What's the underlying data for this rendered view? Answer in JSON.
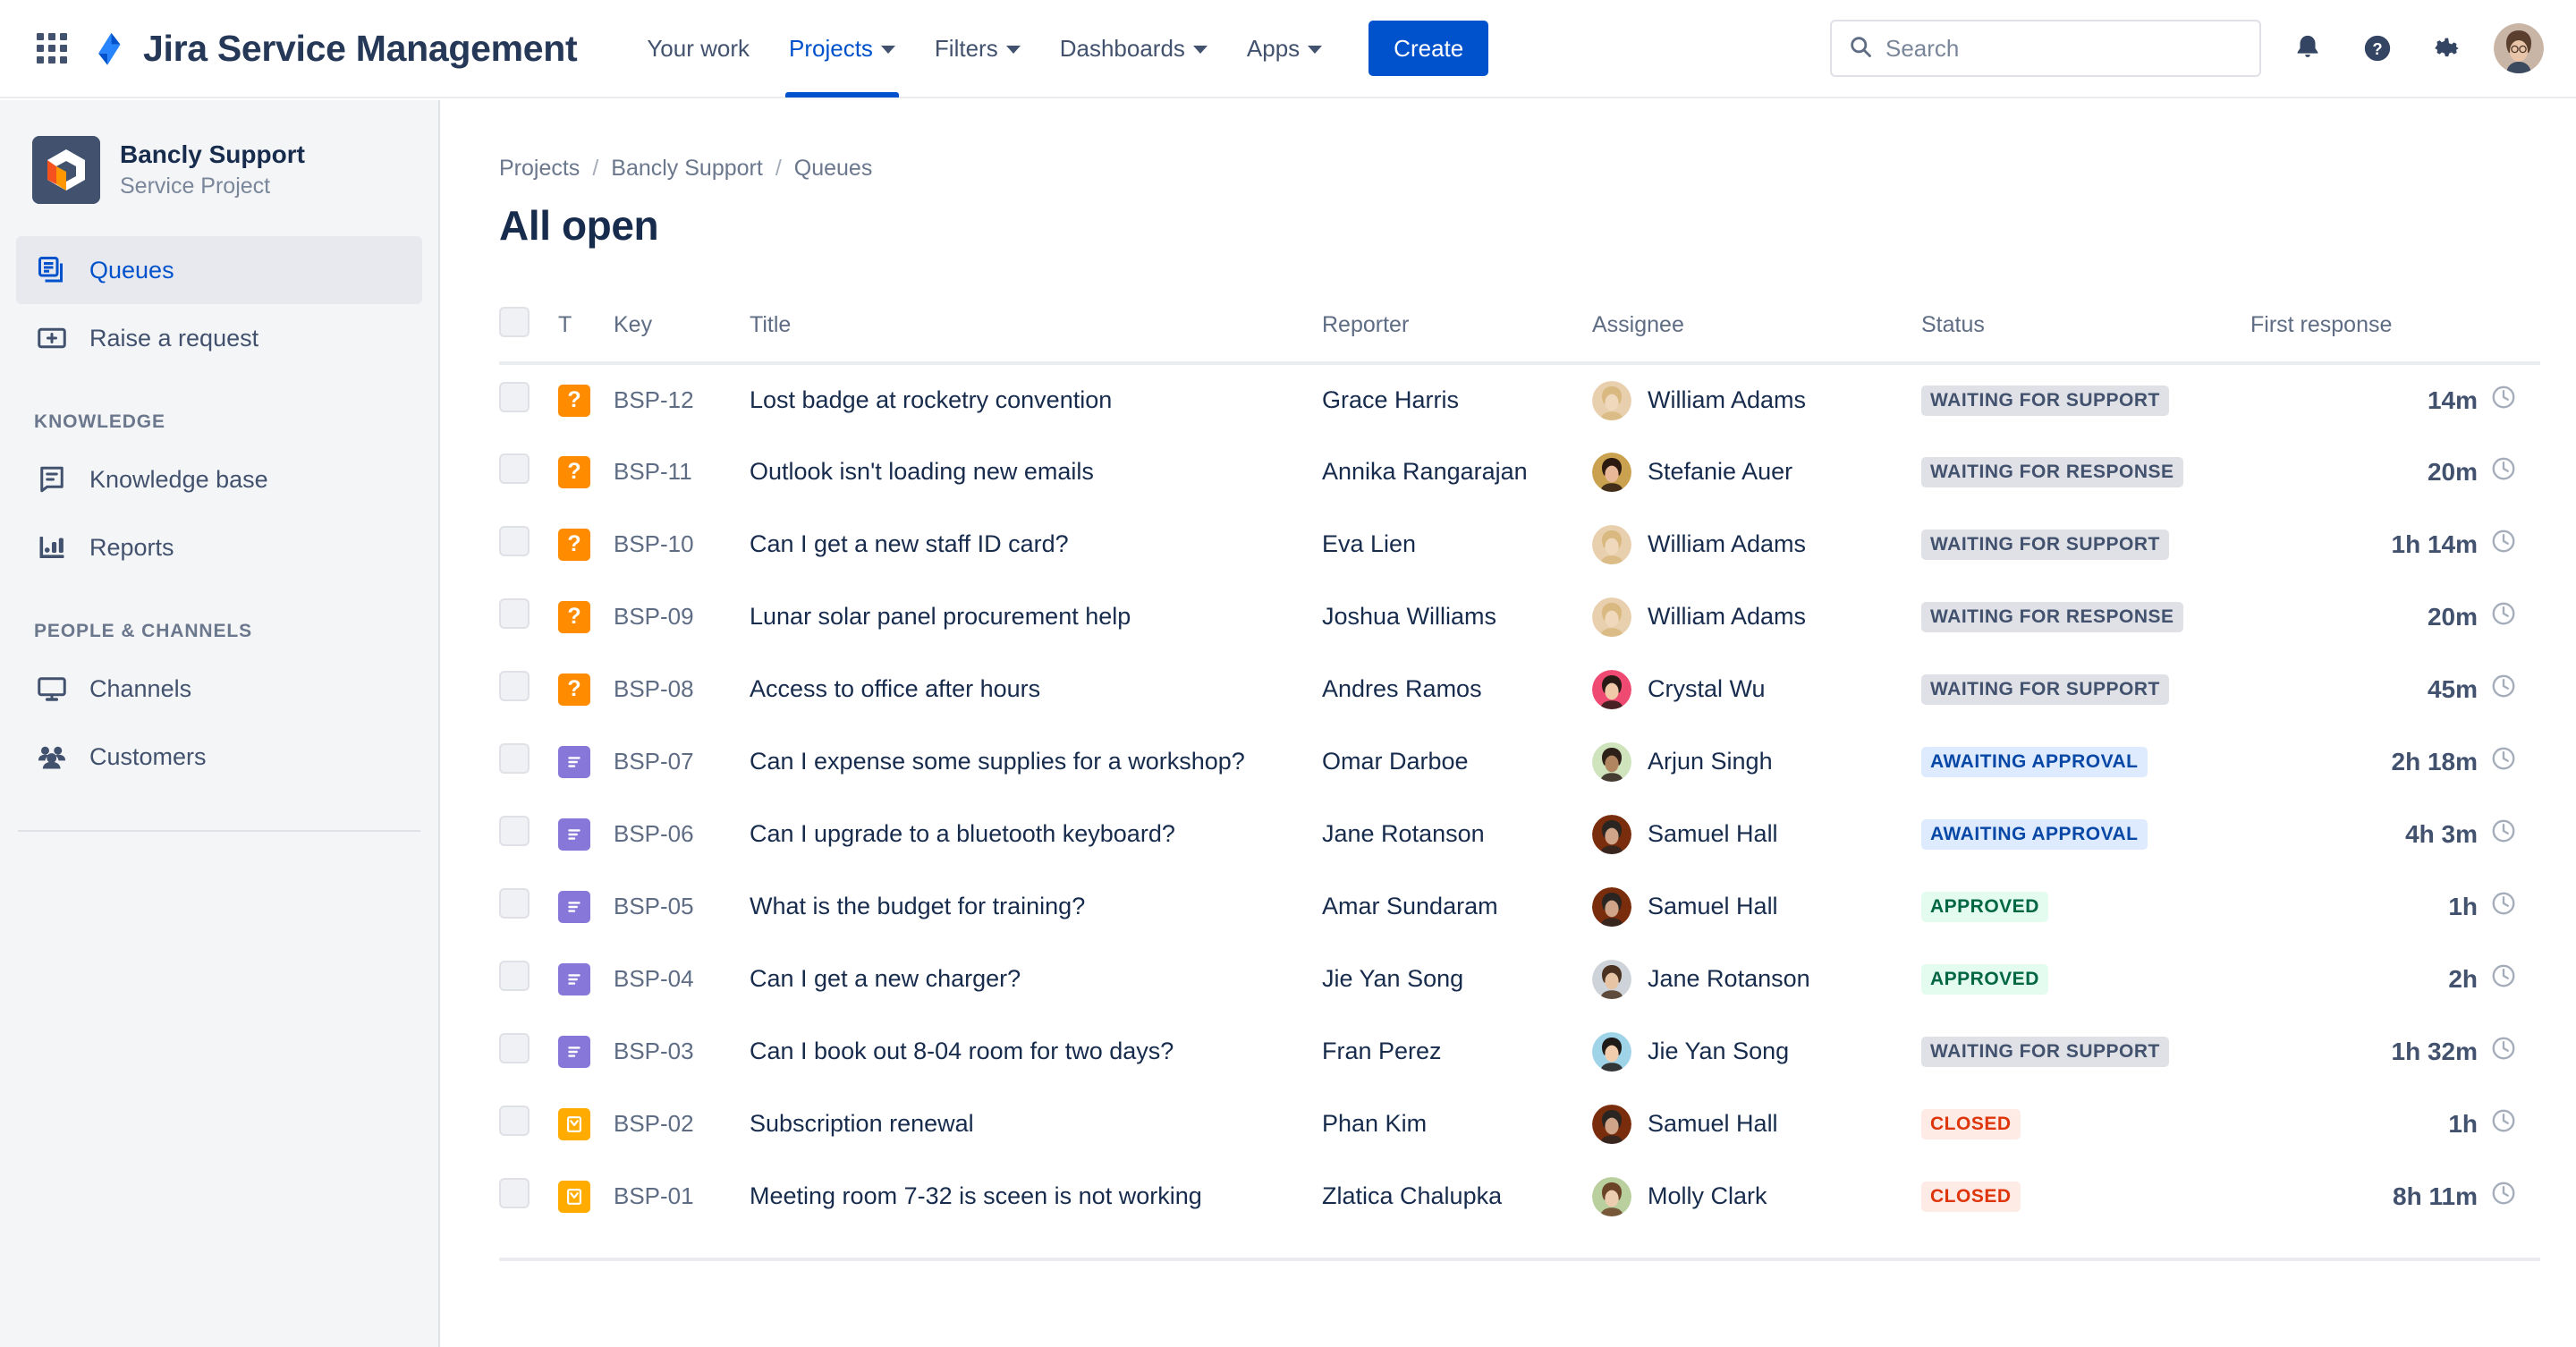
{
  "topnav": {
    "apps_icon": "apps-grid-icon",
    "logo_icon": "jira-logo-icon",
    "brand": "Jira Service Management",
    "links": [
      {
        "label": "Your work",
        "has_caret": false,
        "active": false
      },
      {
        "label": "Projects",
        "has_caret": true,
        "active": true
      },
      {
        "label": "Filters",
        "has_caret": true,
        "active": false
      },
      {
        "label": "Dashboards",
        "has_caret": true,
        "active": false
      },
      {
        "label": "Apps",
        "has_caret": true,
        "active": false
      }
    ],
    "create_label": "Create",
    "search": {
      "placeholder": "Search",
      "value": "",
      "icon": "search-icon"
    },
    "notifications_icon": "notification-bell-icon",
    "help_icon": "help-circle-icon",
    "settings_icon": "gear-icon",
    "profile_icon": "user-avatar"
  },
  "sidebar": {
    "project": {
      "name": "Bancly Support",
      "type": "Service Project",
      "avatar_icon": "project-avatar-icon"
    },
    "items": [
      {
        "label": "Queues",
        "icon": "queues-icon",
        "selected": true
      },
      {
        "label": "Raise a request",
        "icon": "raise-request-icon",
        "selected": false
      }
    ],
    "groups": [
      {
        "title": "KNOWLEDGE",
        "items": [
          {
            "label": "Knowledge base",
            "icon": "book-icon",
            "selected": false
          },
          {
            "label": "Reports",
            "icon": "bar-chart-icon",
            "selected": false
          }
        ]
      },
      {
        "title": "PEOPLE & CHANNELS",
        "items": [
          {
            "label": "Channels",
            "icon": "monitor-icon",
            "selected": false
          },
          {
            "label": "Customers",
            "icon": "people-icon",
            "selected": false
          }
        ]
      }
    ]
  },
  "main": {
    "breadcrumb": [
      "Projects",
      "Bancly Support",
      "Queues"
    ],
    "breadcrumb_separator": "/",
    "page_title": "All open",
    "table": {
      "select_all_icon": "checkbox-unchecked",
      "columns": [
        "T",
        "Key",
        "Title",
        "Reporter",
        "Assignee",
        "Status",
        "First response"
      ],
      "rows": [
        {
          "type": "question",
          "type_glyph": "?",
          "type_color": "#ff8b00",
          "key": "BSP-12",
          "title": "Lost badge at rocketry convention",
          "reporter": "Grace Harris",
          "assignee": "William Adams",
          "status": "WAITING FOR SUPPORT",
          "status_style": "grey",
          "first_response": "14m"
        },
        {
          "type": "question",
          "type_glyph": "?",
          "type_color": "#ff8b00",
          "key": "BSP-11",
          "title": "Outlook isn't loading new emails",
          "reporter": "Annika Rangarajan",
          "assignee": "Stefanie Auer",
          "status": "WAITING FOR RESPONSE",
          "status_style": "grey",
          "first_response": "20m"
        },
        {
          "type": "question",
          "type_glyph": "?",
          "type_color": "#ff8b00",
          "key": "BSP-10",
          "title": "Can I get a new staff ID card?",
          "reporter": "Eva Lien",
          "assignee": "William Adams",
          "status": "WAITING FOR SUPPORT",
          "status_style": "grey",
          "first_response": "1h 14m"
        },
        {
          "type": "question",
          "type_glyph": "?",
          "type_color": "#ff8b00",
          "key": "BSP-09",
          "title": "Lunar solar panel procurement help",
          "reporter": "Joshua Williams",
          "assignee": "William Adams",
          "status": "WAITING FOR RESPONSE",
          "status_style": "grey",
          "first_response": "20m"
        },
        {
          "type": "question",
          "type_glyph": "?",
          "type_color": "#ff8b00",
          "key": "BSP-08",
          "title": "Access to office after hours",
          "reporter": "Andres Ramos",
          "assignee": "Crystal Wu",
          "status": "WAITING FOR SUPPORT",
          "status_style": "grey",
          "first_response": "45m"
        },
        {
          "type": "task",
          "type_glyph": "",
          "type_color": "#8777d9",
          "key": "BSP-07",
          "title": "Can I expense some supplies for a workshop?",
          "reporter": "Omar Darboe",
          "assignee": "Arjun Singh",
          "status": "AWAITING APPROVAL",
          "status_style": "blue",
          "first_response": "2h 18m"
        },
        {
          "type": "task",
          "type_glyph": "",
          "type_color": "#8777d9",
          "key": "BSP-06",
          "title": "Can I upgrade to a bluetooth keyboard?",
          "reporter": "Jane Rotanson",
          "assignee": "Samuel Hall",
          "status": "AWAITING APPROVAL",
          "status_style": "blue",
          "first_response": "4h 3m"
        },
        {
          "type": "task",
          "type_glyph": "",
          "type_color": "#8777d9",
          "key": "BSP-05",
          "title": "What is the budget for training?",
          "reporter": "Amar Sundaram",
          "assignee": "Samuel Hall",
          "status": "APPROVED",
          "status_style": "green",
          "first_response": "1h"
        },
        {
          "type": "task",
          "type_glyph": "",
          "type_color": "#8777d9",
          "key": "BSP-04",
          "title": "Can I get a new charger?",
          "reporter": "Jie Yan Song",
          "assignee": "Jane Rotanson",
          "status": "APPROVED",
          "status_style": "green",
          "first_response": "2h"
        },
        {
          "type": "task",
          "type_glyph": "",
          "type_color": "#8777d9",
          "key": "BSP-03",
          "title": "Can I book out 8-04 room for two days?",
          "reporter": "Fran Perez",
          "assignee": "Jie Yan Song",
          "status": "WAITING FOR SUPPORT",
          "status_style": "grey",
          "first_response": "1h 32m"
        },
        {
          "type": "incident",
          "type_glyph": "",
          "type_color": "#ffab00",
          "key": "BSP-02",
          "title": "Subscription renewal",
          "reporter": "Phan Kim",
          "assignee": "Samuel Hall",
          "status": "CLOSED",
          "status_style": "red",
          "first_response": "1h"
        },
        {
          "type": "incident",
          "type_glyph": "",
          "type_color": "#ffab00",
          "key": "BSP-01",
          "title": "Meeting room 7-32 is sceen is not working",
          "reporter": "Zlatica Chalupka",
          "assignee": "Molly Clark",
          "status": "CLOSED",
          "status_style": "red",
          "first_response": "8h 11m"
        }
      ]
    }
  },
  "colors": {
    "accent": "#0052cc",
    "status_grey": "#dfe1e6",
    "status_blue": "#deebff",
    "status_green": "#e3fcef",
    "status_red": "#ffebe6",
    "type_question": "#ff8b00",
    "type_task": "#8777d9",
    "type_incident": "#ffab00"
  }
}
